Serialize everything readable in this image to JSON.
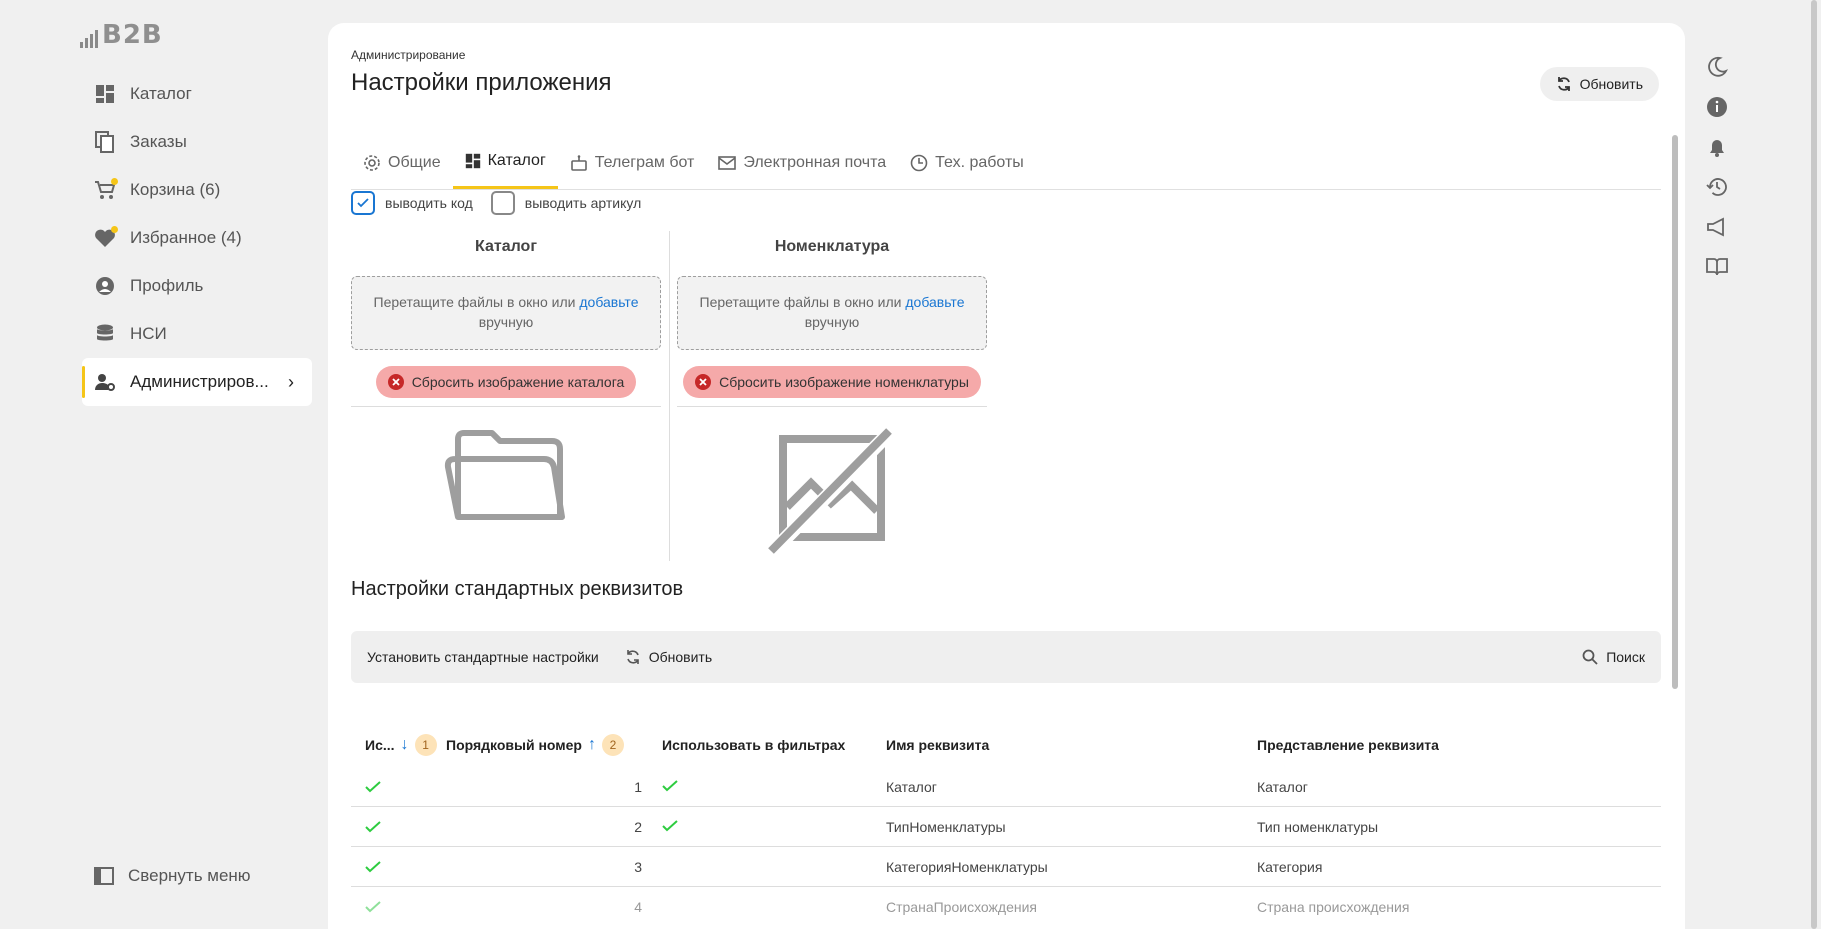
{
  "app": {
    "logo_text": "B2B"
  },
  "sidebar": {
    "items": [
      {
        "label": "Каталог",
        "icon": "dashboard-icon"
      },
      {
        "label": "Заказы",
        "icon": "copy-icon"
      },
      {
        "label": "Корзина (6)",
        "icon": "cart-icon"
      },
      {
        "label": "Избранное (4)",
        "icon": "heart-icon"
      },
      {
        "label": "Профиль",
        "icon": "user-circle-icon"
      },
      {
        "label": "НСИ",
        "icon": "database-icon"
      },
      {
        "label": "Администриров...",
        "icon": "user-gear-icon"
      }
    ],
    "collapse_label": "Свернуть меню"
  },
  "header": {
    "breadcrumb": "Администрирование",
    "title": "Настройки приложения",
    "refresh_label": "Обновить"
  },
  "tabs": [
    {
      "label": "Общие",
      "icon": "gear-icon"
    },
    {
      "label": "Каталог",
      "icon": "dashboard-icon"
    },
    {
      "label": "Телеграм бот",
      "icon": "bot-icon"
    },
    {
      "label": "Электронная почта",
      "icon": "mail-icon"
    },
    {
      "label": "Тех. работы",
      "icon": "clock-icon"
    }
  ],
  "options": {
    "show_code": {
      "label": "выводить код",
      "checked": true
    },
    "show_article": {
      "label": "выводить артикул",
      "checked": false
    }
  },
  "images": {
    "catalog": {
      "title": "Каталог",
      "drop_text": "Перетащите файлы в окно или ",
      "drop_link": "добавьте",
      "drop_text_after": " вручную",
      "reset_label": "Сбросить изображение каталога"
    },
    "nomenclature": {
      "title": "Номенклатура",
      "drop_text": "Перетащите файлы в окно или ",
      "drop_link": "добавьте",
      "drop_text_after": " вручную",
      "reset_label": "Сбросить изображение номенклатуры"
    }
  },
  "requisites": {
    "title": "Настройки стандартных реквизитов",
    "toolbar": {
      "set_defaults_label": "Установить стандартные настройки",
      "refresh_label": "Обновить",
      "search_label": "Поиск"
    },
    "columns": {
      "use": "Ис...",
      "use_sort_badge": "1",
      "order": "Порядковый номер",
      "order_sort_badge": "2",
      "use_in_filters": "Использовать в фильтрах",
      "name": "Имя реквизита",
      "presentation": "Представление реквизита"
    },
    "rows": [
      {
        "use": true,
        "order": "1",
        "filters": true,
        "name": "Каталог",
        "presentation": "Каталог"
      },
      {
        "use": true,
        "order": "2",
        "filters": true,
        "name": "ТипНоменклатуры",
        "presentation": "Тип номенклатуры"
      },
      {
        "use": true,
        "order": "3",
        "filters": false,
        "name": "КатегорияНоменклатуры",
        "presentation": "Категория"
      },
      {
        "use": true,
        "order": "4",
        "filters": false,
        "name": "СтранаПроисхождения",
        "presentation": "Страна происхождения"
      }
    ]
  },
  "colors": {
    "accent": "#f5c518",
    "link": "#1976d2",
    "check": "#2ecc40",
    "reset_bg": "#f5a9a9"
  }
}
